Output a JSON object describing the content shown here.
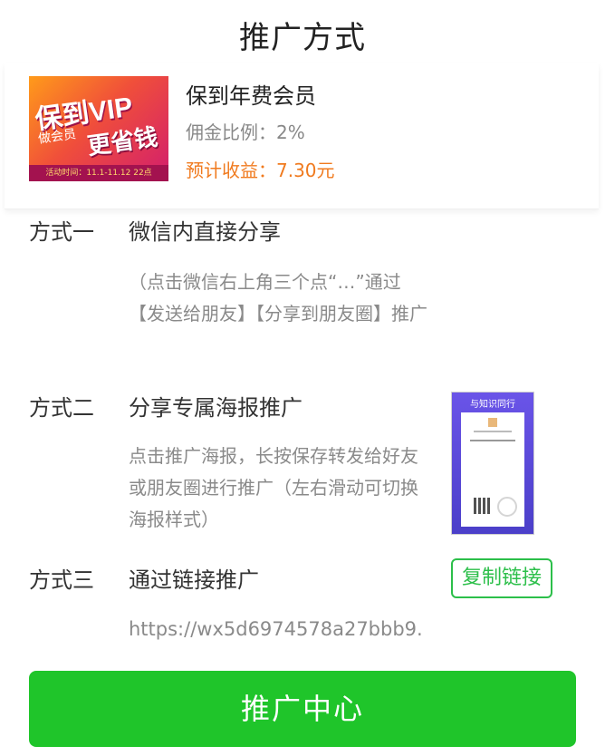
{
  "header": {
    "title": "推广方式"
  },
  "product": {
    "banner": {
      "line1": "保到VIP",
      "line2": "做会员",
      "line3": "更省钱",
      "footer": "活动时间：11.1-11.12 22点"
    },
    "name": "保到年费会员",
    "commission": "佣金比例：2%",
    "income": "预计收益：7.30元"
  },
  "methods": [
    {
      "label": "方式一",
      "title": "微信内直接分享",
      "desc": "（点击微信右上角三个点“…”通过【发送给朋友】【分享到朋友圈】推广"
    },
    {
      "label": "方式二",
      "title": "分享专属海报推广",
      "desc": "点击推广海报，长按保存转发给好友或朋友圈进行推广（左右滑动可切换海报样式）",
      "poster_title": "与知识同行"
    },
    {
      "label": "方式三",
      "title": "通过链接推广",
      "copy_label": "复制链接",
      "link": "https://wx5d6974578a27bbb9."
    }
  ],
  "footer": {
    "main_button": "推广中心"
  },
  "colors": {
    "accent_green": "#1fc52a",
    "copy_green": "#2cbf4a",
    "income_orange": "#f07a1e"
  }
}
